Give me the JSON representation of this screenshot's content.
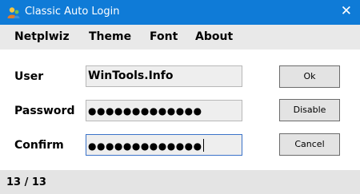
{
  "window": {
    "title": "Classic Auto Login",
    "app_icon": "user-icon",
    "close_icon": "close-icon",
    "close_glyph": "✕",
    "accent_color": "#0f7bd7"
  },
  "menu": {
    "items": [
      "Netplwiz",
      "Theme",
      "Font",
      "About"
    ]
  },
  "form": {
    "user_label": "User",
    "user_value": "WinTools.Info",
    "password_label": "Password",
    "password_value": "●●●●●●●●●●●●●",
    "confirm_label": "Confirm",
    "confirm_value": "●●●●●●●●●●●●●"
  },
  "buttons": {
    "ok": "Ok",
    "disable": "Disable",
    "cancel": "Cancel"
  },
  "status": {
    "text": "13 / 13"
  }
}
